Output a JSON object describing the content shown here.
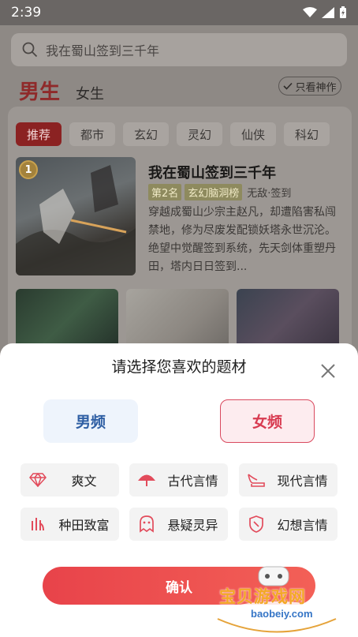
{
  "status": {
    "time": "2:39"
  },
  "search": {
    "placeholder": "我在蜀山签到三千年"
  },
  "gender_tabs": {
    "male": "男生",
    "female": "女生",
    "only_god": "只看神作"
  },
  "categories": [
    "推荐",
    "都市",
    "玄幻",
    "灵幻",
    "仙侠",
    "科幻"
  ],
  "featured": {
    "rank": "1",
    "title": "我在蜀山签到三千年",
    "tag_rank": "第2名",
    "tag_list": "玄幻脑洞榜",
    "tag_genre": "无敌·签到",
    "description": "穿越成蜀山少宗主赵凡，却遭陷害私闯禁地，修为尽废发配锁妖塔永世沉沦。绝望中觉醒签到系统，先天剑体重塑丹田，塔内日日签到..."
  },
  "sheet": {
    "title": "请选择您喜欢的题材",
    "male_freq": "男频",
    "female_freq": "女频",
    "genres": [
      "爽文",
      "古代言情",
      "现代言情",
      "种田致富",
      "悬疑灵异",
      "幻想言情"
    ],
    "confirm": "确认"
  },
  "watermark": {
    "cn": "宝贝游戏网",
    "url": "baobeiy.com"
  },
  "colors": {
    "accent": "#e8434a",
    "female": "#d83b51",
    "male": "#2f5fa4"
  }
}
